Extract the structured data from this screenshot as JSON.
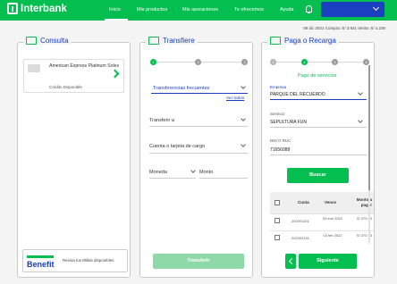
{
  "brand": {
    "name": "Interbank"
  },
  "nav": {
    "items": [
      "Inicio",
      "Mis productos",
      "Mis operaciones",
      "Te ofrecemos",
      "Ayuda"
    ]
  },
  "rates": "08 dic 2021   Compra: S/ 3.921   Venta: S/ 4.235",
  "consulta": {
    "title": "Consulta",
    "card": {
      "name": "American Express Platinum Soles",
      "status": "Crédito Disponible"
    },
    "benefit": {
      "logo": "Benefit",
      "text": "Revisa tus Millas disponibles"
    }
  },
  "transfiere": {
    "title": "Transfiere",
    "steps": [
      "1",
      "2",
      "3"
    ],
    "frequent": "Transferencias frecuentes",
    "see": "Ver todos",
    "to": "Transferir a",
    "account": "Cuenta o tarjeta de cargo",
    "currency": "Moneda",
    "amount": "Monto",
    "button": "Transferir"
  },
  "pago": {
    "title": "Paga o Recarga",
    "steps": [
      "1",
      "2",
      "3",
      "4"
    ],
    "subtitle": "Pago de servicios",
    "empresa_label": "Empresa",
    "empresa_value": "PARQUE DEL RECUERDO",
    "servicio_label": "Servicio",
    "servicio_value": "SEPULTURA FUN",
    "dni_label": "DNI O RUC",
    "dni_value": "71656088",
    "search_button": "Buscar",
    "table": {
      "headers": [
        "Cuota",
        "Vence",
        "Monto a pagar"
      ],
      "rows": [
        {
          "cuota": "202201101",
          "vence": "03 ene 2022",
          "monto": "S/ 370.93"
        },
        {
          "cuota": "202202101",
          "vence": "03 feb 2022",
          "monto": "S/ 370.93"
        }
      ]
    },
    "next_button": "Siguiente"
  }
}
